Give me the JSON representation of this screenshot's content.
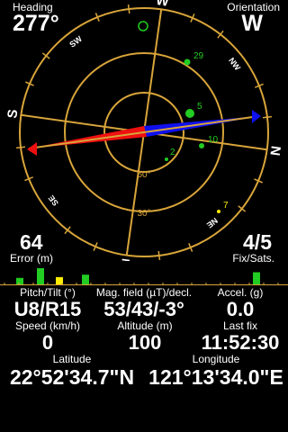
{
  "header": {
    "heading_label": "Heading",
    "heading_value": "277°",
    "orientation_label": "Orientation",
    "orientation_value": "W"
  },
  "compass": {
    "labels": [
      {
        "text": "W",
        "angle": 0
      },
      {
        "text": "NW",
        "angle": 45
      },
      {
        "text": "N",
        "angle": 90
      },
      {
        "text": "NE",
        "angle": 135
      },
      {
        "text": "E",
        "angle": 180
      },
      {
        "text": "SE",
        "angle": 225
      },
      {
        "text": "S",
        "angle": 270
      },
      {
        "text": "SW",
        "angle": 315
      }
    ],
    "elevation_labels": [
      "60°",
      "30°"
    ],
    "needle_angle": 277,
    "satellites": [
      {
        "id": "29",
        "color": "#22cc22"
      },
      {
        "id": "5",
        "color": "#22cc22"
      },
      {
        "id": "10",
        "color": "#22cc22"
      },
      {
        "id": "2",
        "color": "#22cc22"
      },
      {
        "id": "7",
        "color": "#ffee00"
      }
    ]
  },
  "error": {
    "value": "64",
    "label": "Error (m)"
  },
  "fix": {
    "value": "4/5",
    "label": "Fix/Sats."
  },
  "signal_bars": [
    {
      "color": "#22cc22",
      "level": 0.4
    },
    {
      "color": "#22cc22",
      "level": 1.0
    },
    {
      "color": "#ffee00",
      "level": 0.45
    },
    {
      "color": "#22cc22",
      "level": 0.6
    },
    {
      "color": "#22cc22",
      "level": 0.75
    }
  ],
  "stats": {
    "pitch_label": "Pitch/Tilt (°)",
    "pitch_value": "U8/R15",
    "mag_label": "Mag. field (µT)/decl.",
    "mag_value": "53/43/-3°",
    "accel_label": "Accel. (g)",
    "accel_value": "0.0",
    "speed_label": "Speed (km/h)",
    "speed_value": "0",
    "alt_label": "Altitude (m)",
    "alt_value": "100",
    "lastfix_label": "Last fix",
    "lastfix_value": "11:52:30",
    "lat_label": "Latitude",
    "lat_value": "22°52'34.7\"N",
    "lon_label": "Longitude",
    "lon_value": "121°13'34.0\"E"
  },
  "colors": {
    "ring": "#d8a53a",
    "needle_north": "#1010ee",
    "needle_south": "#ee1010",
    "baseline": "#d8a53a"
  }
}
